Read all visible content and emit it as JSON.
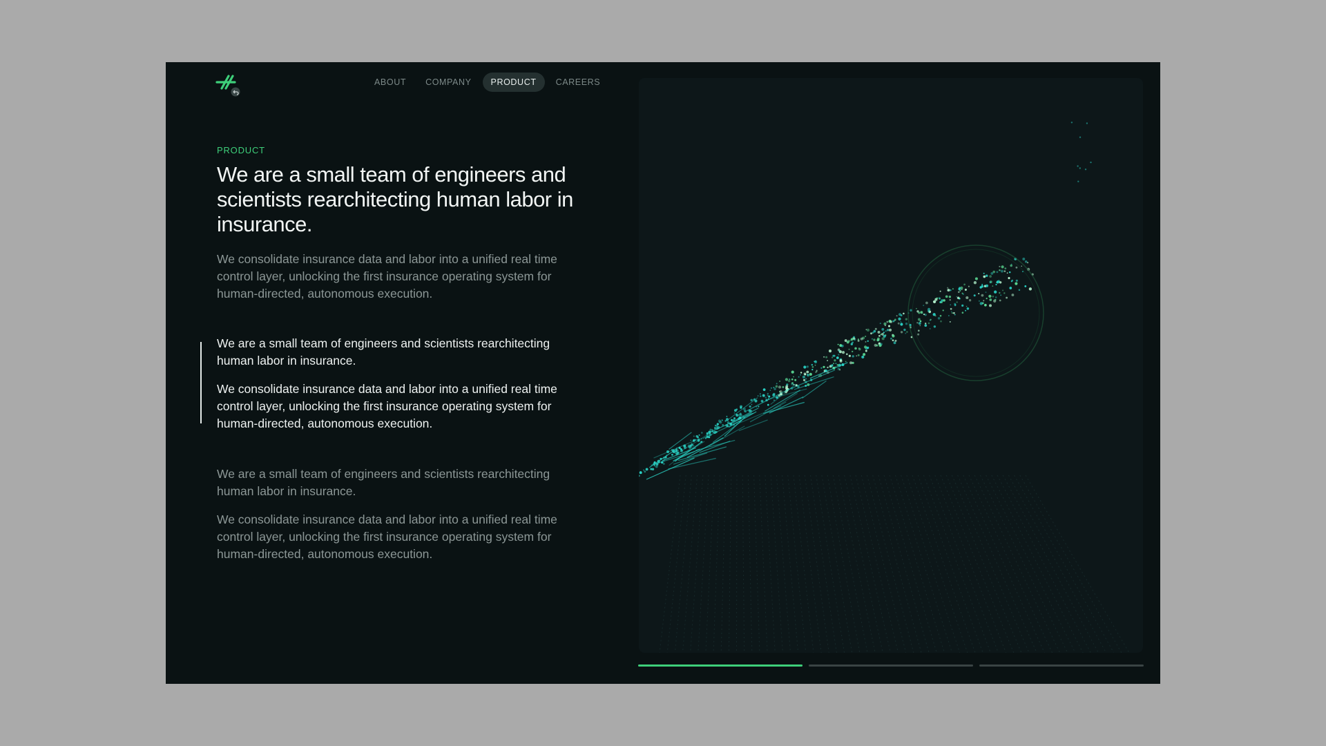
{
  "brand": {
    "logo_icon": "logo-asterisk-icon",
    "accent": "#3ecf7a"
  },
  "nav": {
    "items": [
      {
        "label": "ABOUT",
        "active": false
      },
      {
        "label": "COMPANY",
        "active": false
      },
      {
        "label": "PRODUCT",
        "active": true
      },
      {
        "label": "CAREERS",
        "active": false
      }
    ]
  },
  "hero": {
    "eyebrow": "PRODUCT",
    "headline": "We are a small team of engineers and scientists rearchitecting human labor in insurance.",
    "lead": "We consolidate insurance data and labor into a unified real time control layer, unlocking the first insurance operating system for human-directed, autonomous execution."
  },
  "features": [
    {
      "title": "We are a small team of engineers and scientists rearchitecting human labor in insurance.",
      "body": "We consolidate insurance data and labor into a unified real time control layer, unlocking the first insurance operating system for human-directed, autonomous execution.",
      "active": true
    },
    {
      "title": "We are a small team of engineers and scientists rearchitecting human labor in insurance.",
      "body": "We consolidate insurance data and labor into a unified real time control layer, unlocking the first insurance operating system for human-directed, autonomous execution.",
      "active": false
    }
  ],
  "carousel": {
    "segments": [
      {
        "progress": 1.0
      },
      {
        "progress": 0.0
      },
      {
        "progress": 0.0
      }
    ]
  },
  "colors": {
    "background": "#0a1213",
    "viz_panel": "#0d1719",
    "particle_green": "#5fe39a",
    "particle_teal": "#2ad1c4"
  }
}
